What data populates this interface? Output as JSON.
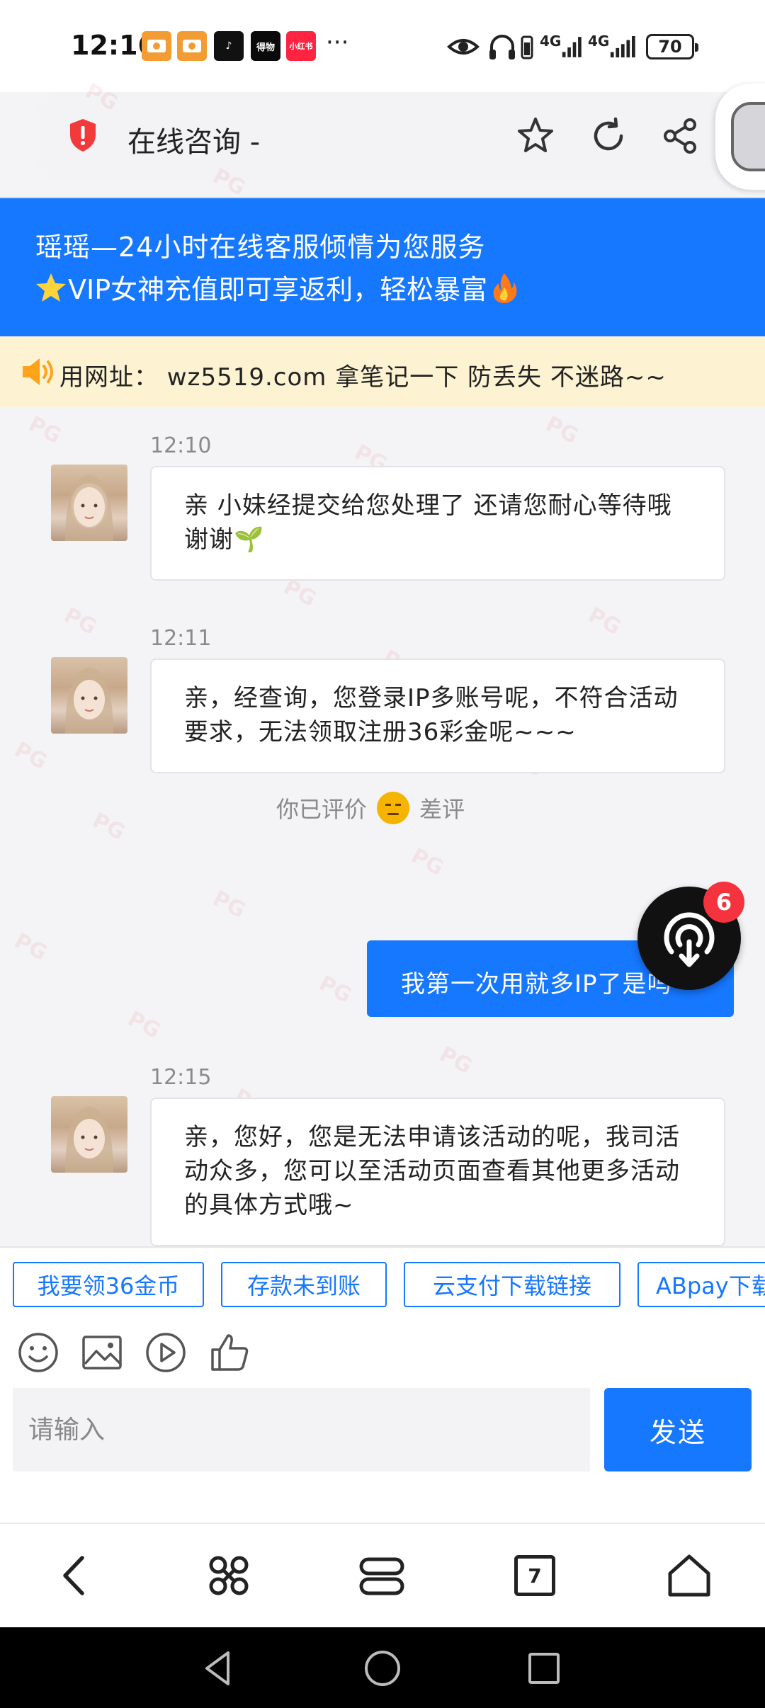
{
  "status_bar": {
    "time": "12:16",
    "more": "···",
    "network1": "4G",
    "network2": "4G",
    "battery": "70",
    "notifications": [
      {
        "name": "app-notif-1",
        "label": "",
        "color": "#f39c33"
      },
      {
        "name": "app-notif-2",
        "label": "",
        "color": "#f39c33"
      },
      {
        "name": "tiktok-notif",
        "label": "♪",
        "color": "#111111"
      },
      {
        "name": "news-notif",
        "label": "得物",
        "color": "#0a0a0a"
      },
      {
        "name": "xiaohongshu-notif",
        "label": "小红书",
        "color": "#ff2442"
      }
    ]
  },
  "url_bar": {
    "title": "在线咨询 -"
  },
  "banner": {
    "line1": "瑶瑶—24小时在线客服倾情为您服务",
    "line2": "VIP女神充值即可享返利，轻松暴富"
  },
  "notice": {
    "text": "用网址：  wz5519.com 拿笔记一下 防丢失 不迷路~~"
  },
  "chat": {
    "messages": [
      {
        "time": "12:10",
        "text": "亲 小妹经提交给您处理了 还请您耐心等待哦谢谢🌱"
      },
      {
        "time": "12:11",
        "text": "亲，经查询，您登录IP多账号呢，不符合活动要求，无法领取注册36彩金呢~~~"
      },
      {
        "time": "12:15",
        "text": "亲，您好，您是无法申请该活动的呢，我司活动众多，您可以至活动页面查看其他更多活动的具体方式哦~"
      }
    ],
    "rating_prefix": "你已评价",
    "rating_value": "差评",
    "user_message": "我第一次用就多IP了是吗"
  },
  "float_button": {
    "badge": "6"
  },
  "quick_replies": [
    "我要领36金币",
    "存款未到账",
    "云支付下载链接",
    "ABpay下载"
  ],
  "input": {
    "placeholder": "请输入",
    "send_label": "发送"
  },
  "browser_nav": {
    "tab_count": "7"
  },
  "colors": {
    "accent": "#1677ff",
    "notice_bg": "#fdf3d3",
    "badge": "#f5333f"
  }
}
